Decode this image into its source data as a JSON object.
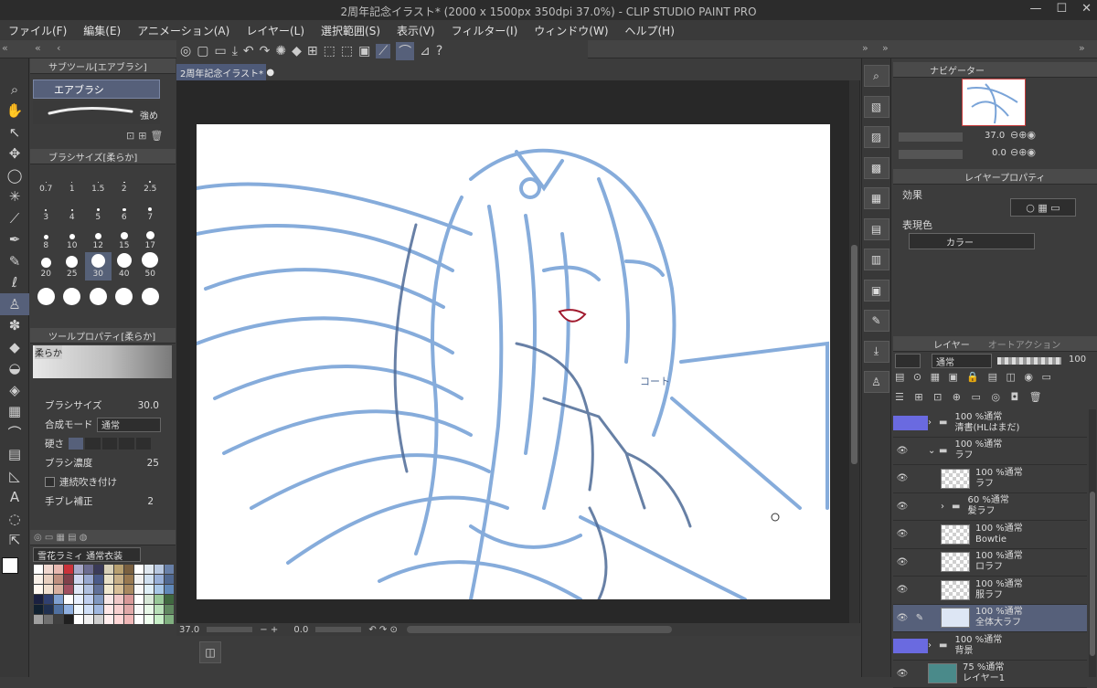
{
  "window": {
    "title": "2周年記念イラスト* (2000 x 1500px 350dpi 37.0%) - CLIP STUDIO PAINT PRO",
    "minimize": "—",
    "maximize": "☐",
    "close": "✕"
  },
  "menu": [
    "ファイル(F)",
    "編集(E)",
    "アニメーション(A)",
    "レイヤー(L)",
    "選択範囲(S)",
    "表示(V)",
    "フィルター(I)",
    "ウィンドウ(W)",
    "ヘルプ(H)"
  ],
  "subtool": {
    "header": "サブツール[エアブラシ]",
    "selected": "エアブラシ",
    "stroke_label": "強め"
  },
  "brushsize": {
    "header": "ブラシサイズ[柔らか]",
    "sizes": [
      "0.7",
      "1",
      "1.5",
      "2",
      "2.5",
      "3",
      "4",
      "5",
      "6",
      "7",
      "8",
      "10",
      "12",
      "15",
      "17",
      "20",
      "25",
      "30",
      "40",
      "50",
      "",
      "",
      "",
      "",
      ""
    ],
    "selected": "30"
  },
  "toolprop": {
    "header": "ツールプロパティ[柔らか]",
    "preset": "柔らか",
    "size_label": "ブラシサイズ",
    "size_value": "30.0",
    "blend_label": "合成モード",
    "blend_value": "通常",
    "hardness_label": "硬さ",
    "density_label": "ブラシ濃度",
    "density_value": "25",
    "continuous_label": "連続吹き付け",
    "stabilize_label": "手ブレ補正",
    "stabilize_value": "2"
  },
  "colorset": {
    "name": "雪花ラミィ 通常衣装"
  },
  "canvas": {
    "tab": "2周年記念イラスト*",
    "annotation": "コート",
    "zoom": "37.0",
    "rotation": "0.0"
  },
  "navigator": {
    "header": "ナビゲーター",
    "zoom": "37.0",
    "rotation": "0.0"
  },
  "layerprop": {
    "header": "レイヤープロパティ",
    "effect_label": "効果",
    "color_label": "表現色",
    "color_value": "カラー"
  },
  "layers": {
    "tab1": "レイヤー",
    "tab2": "オートアクション",
    "blend": "通常",
    "opacity": "100",
    "items": [
      {
        "mode": "100 %通常",
        "name": "清書(HLはまだ)",
        "type": "folder"
      },
      {
        "mode": "100 %通常",
        "name": "ラフ",
        "type": "folder-open"
      },
      {
        "mode": "100 %通常",
        "name": "ラフ",
        "type": "layer"
      },
      {
        "mode": "60 %通常",
        "name": "髪ラフ",
        "type": "folder"
      },
      {
        "mode": "100 %通常",
        "name": "Bowtie",
        "type": "layer"
      },
      {
        "mode": "100 %通常",
        "name": "ロラフ",
        "type": "layer"
      },
      {
        "mode": "100 %通常",
        "name": "服ラフ",
        "type": "layer"
      },
      {
        "mode": "100 %通常",
        "name": "全体大ラフ",
        "type": "layer-selected"
      },
      {
        "mode": "100 %通常",
        "name": "背景",
        "type": "folder"
      },
      {
        "mode": "75 %通常",
        "name": "レイヤー1",
        "type": "layer-teal"
      }
    ]
  },
  "colors": {
    "accent": "#5a6a92",
    "sketch": "#7aa4d8",
    "sketchdark": "#4d6a96",
    "fg": "#ffffff",
    "bg": "#c9323a"
  }
}
